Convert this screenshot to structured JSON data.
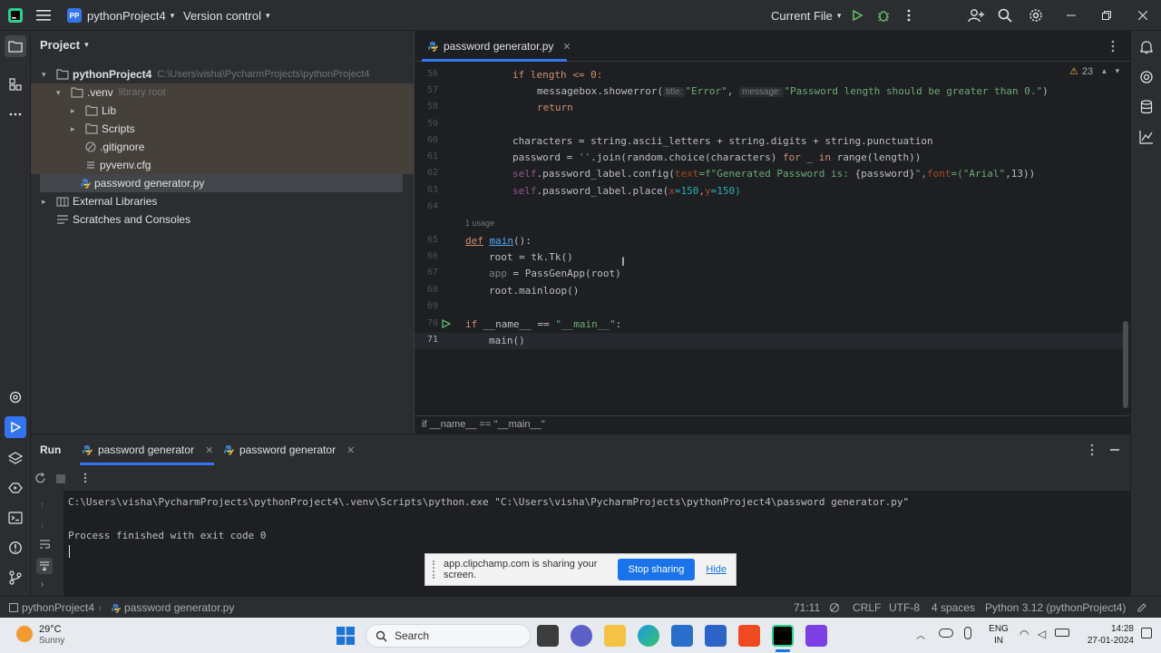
{
  "titlebar": {
    "project_badge": "PP",
    "project_name": "pythonProject4",
    "vcs": "Version control",
    "run_config": "Current File"
  },
  "project_panel": {
    "title": "Project",
    "tree": [
      {
        "label": "pythonProject4",
        "extra": "C:\\Users\\visha\\PycharmProjects\\pythonProject4"
      },
      {
        "label": ".venv",
        "extra": "library root"
      },
      {
        "label": "Lib",
        "extra": ""
      },
      {
        "label": "Scripts",
        "extra": ""
      },
      {
        "label": ".gitignore",
        "extra": ""
      },
      {
        "label": "pyvenv.cfg",
        "extra": ""
      },
      {
        "label": "password generator.py",
        "extra": ""
      },
      {
        "label": "External Libraries",
        "extra": ""
      },
      {
        "label": "Scratches and Consoles",
        "extra": ""
      }
    ]
  },
  "editor": {
    "tab_label": "password generator.py",
    "warnings_count": "23",
    "usage_hint": "1 usage",
    "breadcrumb": "if __name__ == \"__main__\"",
    "line_numbers": [
      "56",
      "57",
      "58",
      "59",
      "60",
      "61",
      "62",
      "63",
      "64",
      "65",
      "66",
      "67",
      "68",
      "69",
      "70",
      "71"
    ],
    "lines": {
      "l56_a": "if length <= 0:",
      "l57_a": "messagebox.showerror(",
      "l57_hint1": "title:",
      "l57_s1": "\"Error\"",
      "l57_hint2": "message:",
      "l57_s2": "\"Password length should be greater than 0.\"",
      "l57_end": ")",
      "l58": "return",
      "l60": "characters = string.ascii_letters + string.digits + string.punctuation",
      "l61_a": "password = ",
      "l61_s": "''",
      "l61_b": ".join(random.choice(characters) ",
      "l61_kw1": "for",
      "l61_c": " _ ",
      "l61_kw2": "in",
      "l61_d": " range(length))",
      "l62_self": "self",
      "l62_a": ".password_label.config(",
      "l62_p1": "text",
      "l62_s1": "=f\"Generated Password is: ",
      "l62_b": "{password}",
      "l62_s1e": "\"",
      "l62_c": ",",
      "l62_p2": "font",
      "l62_s2": "=(\"Arial\"",
      "l62_d": ",13))",
      "l63_self": "self",
      "l63_a": ".password_label.place(",
      "l63_p1": "x",
      "l63_v1": "=150",
      "l63_c": ",",
      "l63_p2": "y",
      "l63_v2": "=150)",
      "l65_kw": "def",
      "l65_fn": "main",
      "l65_rest": "():",
      "l66": "root = tk.Tk()",
      "l67_a": "app",
      "l67_b": " = PassGenApp(root)",
      "l68": "root.mainloop()",
      "l70_kw": "if",
      "l70_a": " __name__ == ",
      "l70_s": "\"__main__\"",
      "l70_b": ":",
      "l71": "main()"
    }
  },
  "run_panel": {
    "title": "Run",
    "tab1": "password generator",
    "tab2": "password generator",
    "console_cmd": "C:\\Users\\visha\\PycharmProjects\\pythonProject4\\.venv\\Scripts\\python.exe \"C:\\Users\\visha\\PycharmProjects\\pythonProject4\\password generator.py\"",
    "console_exit": "Process finished with exit code 0"
  },
  "share_banner": {
    "message": "app.clipchamp.com is sharing your screen.",
    "stop_label": "Stop sharing",
    "hide_label": "Hide"
  },
  "statusbar": {
    "project": "pythonProject4",
    "file": "password generator.py",
    "position": "71:11",
    "line_sep": "CRLF",
    "encoding": "UTF-8",
    "indent": "4 spaces",
    "interpreter": "Python 3.12 (pythonProject4)"
  },
  "taskbar": {
    "temp": "29°C",
    "weather": "Sunny",
    "search_label": "Search",
    "lang1": "ENG",
    "lang2": "IN",
    "time": "14:28",
    "date": "27-01-2024"
  },
  "colors": {
    "accent": "#3574f0",
    "editor_bg": "#1e1f22",
    "panel_bg": "#2b2d30"
  }
}
